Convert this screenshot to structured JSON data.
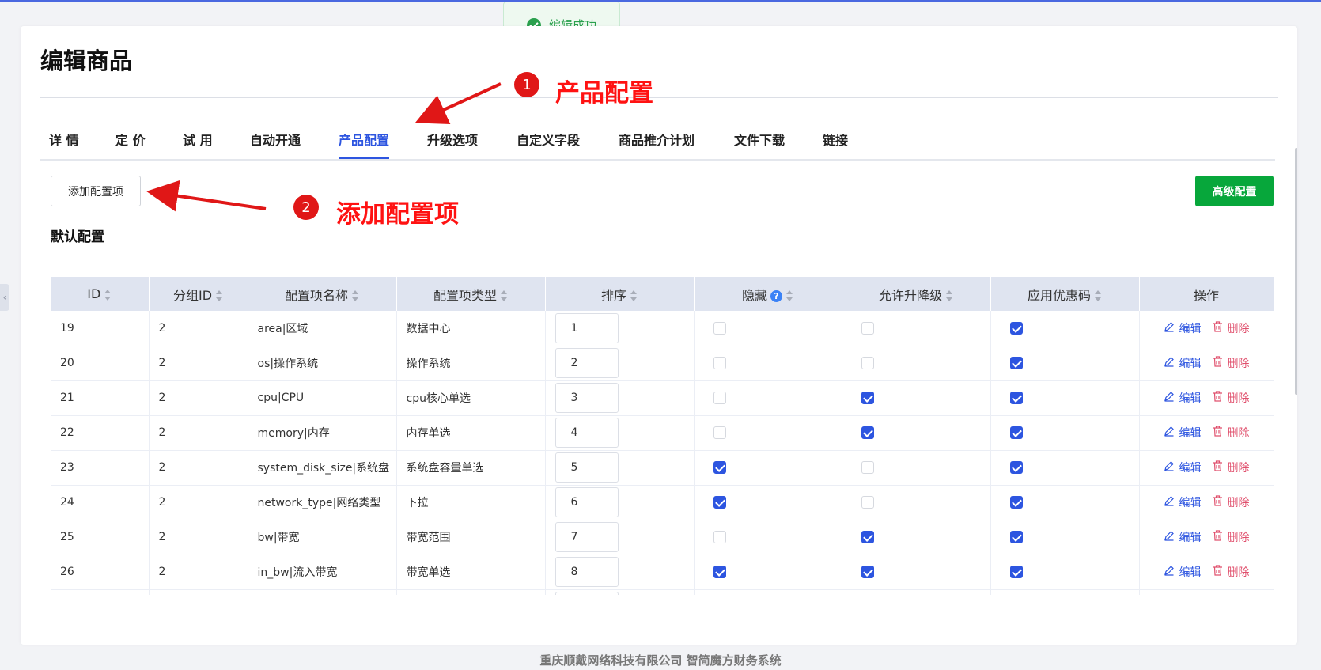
{
  "page": {
    "title": "编辑商品",
    "section_title": "默认配置",
    "footer": "重庆顺戴网络科技有限公司 智简魔方财务系统"
  },
  "toast": {
    "text": "编辑成功"
  },
  "tabs": [
    {
      "label": "详 情"
    },
    {
      "label": "定 价"
    },
    {
      "label": "试 用"
    },
    {
      "label": "自动开通"
    },
    {
      "label": "产品配置",
      "active": true
    },
    {
      "label": "升级选项"
    },
    {
      "label": "自定义字段"
    },
    {
      "label": "商品推介计划"
    },
    {
      "label": "文件下载"
    },
    {
      "label": "链接"
    }
  ],
  "buttons": {
    "add_config": "添加配置项",
    "advanced_config": "高级配置"
  },
  "table": {
    "headers": {
      "id": "ID",
      "group_id": "分组ID",
      "name": "配置项名称",
      "type": "配置项类型",
      "order": "排序",
      "hidden": "隐藏",
      "upgrade": "允许升降级",
      "coupon": "应用优惠码",
      "actions": "操作"
    },
    "edit_label": "编辑",
    "delete_label": "删除",
    "rows": [
      {
        "id": "19",
        "group_id": "2",
        "name": "area|区域",
        "type": "数据中心",
        "order": "1",
        "hidden": false,
        "upgrade": false,
        "coupon": true
      },
      {
        "id": "20",
        "group_id": "2",
        "name": "os|操作系统",
        "type": "操作系统",
        "order": "2",
        "hidden": false,
        "upgrade": false,
        "coupon": true
      },
      {
        "id": "21",
        "group_id": "2",
        "name": "cpu|CPU",
        "type": "cpu核心单选",
        "order": "3",
        "hidden": false,
        "upgrade": true,
        "coupon": true
      },
      {
        "id": "22",
        "group_id": "2",
        "name": "memory|内存",
        "type": "内存单选",
        "order": "4",
        "hidden": false,
        "upgrade": true,
        "coupon": true
      },
      {
        "id": "23",
        "group_id": "2",
        "name": "system_disk_size|系统盘",
        "type": "系统盘容量单选",
        "order": "5",
        "hidden": true,
        "upgrade": false,
        "coupon": true
      },
      {
        "id": "24",
        "group_id": "2",
        "name": "network_type|网络类型",
        "type": "下拉",
        "order": "6",
        "hidden": true,
        "upgrade": false,
        "coupon": true
      },
      {
        "id": "25",
        "group_id": "2",
        "name": "bw|带宽",
        "type": "带宽范围",
        "order": "7",
        "hidden": false,
        "upgrade": true,
        "coupon": true
      },
      {
        "id": "26",
        "group_id": "2",
        "name": "in_bw|流入带宽",
        "type": "带宽单选",
        "order": "8",
        "hidden": true,
        "upgrade": true,
        "coupon": true
      }
    ]
  },
  "annotations": [
    {
      "number": "1",
      "text": "产品配置"
    },
    {
      "number": "2",
      "text": "添加配置项"
    }
  ],
  "colors": {
    "accent": "#2d55e0",
    "success": "#07a73b",
    "danger": "#e0506d",
    "annotation": "#ff1212"
  }
}
